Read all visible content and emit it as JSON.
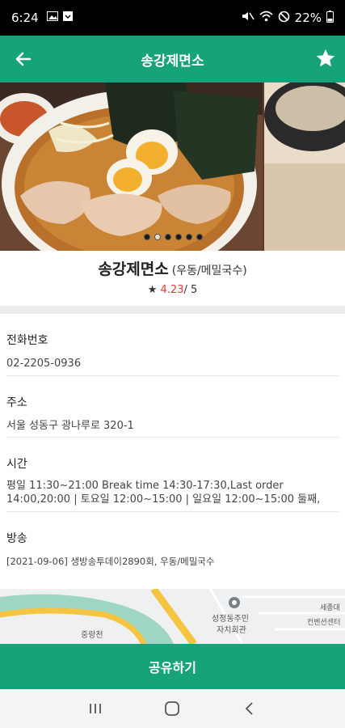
{
  "status_bar": {
    "time": "6:24",
    "battery": "22%",
    "icons": [
      "gallery-icon",
      "download-icon",
      "mute-icon",
      "wifi-icon",
      "blocked-icon",
      "battery-icon"
    ]
  },
  "app_bar": {
    "title": "송강제면소",
    "back_icon": "arrow-left-icon",
    "favorite_icon": "star-icon"
  },
  "gallery": {
    "slide_count": 6,
    "active_index": 1
  },
  "restaurant": {
    "name": "송강제면소",
    "category": "(우동/메밀국수)",
    "star": "★",
    "rating": "4.23",
    "rating_max": "/ 5"
  },
  "details": {
    "phone_label": "전화번호",
    "phone_value": "02-2205-0936",
    "address_label": "주소",
    "address_value": "서울 성동구 광나루로 320-1",
    "hours_label": "시간",
    "hours_value": "평일 11:30~21:00 Break time 14:30-17:30,Last order 14:00,20:00 | 토요일 12:00~15:00 | 일요일 12:00~15:00 둘째,",
    "broadcast_label": "방송",
    "broadcast_value": "[2021-09-06] 생방송투데이2890회, 우동/메밀국수"
  },
  "map": {
    "labels": [
      "중랑천",
      "성정동주민",
      "자치회관",
      "세종대",
      "컨벤션센터"
    ]
  },
  "share_button": "공유하기",
  "colors": {
    "primary": "#16a37a",
    "rating": "#e53935"
  }
}
